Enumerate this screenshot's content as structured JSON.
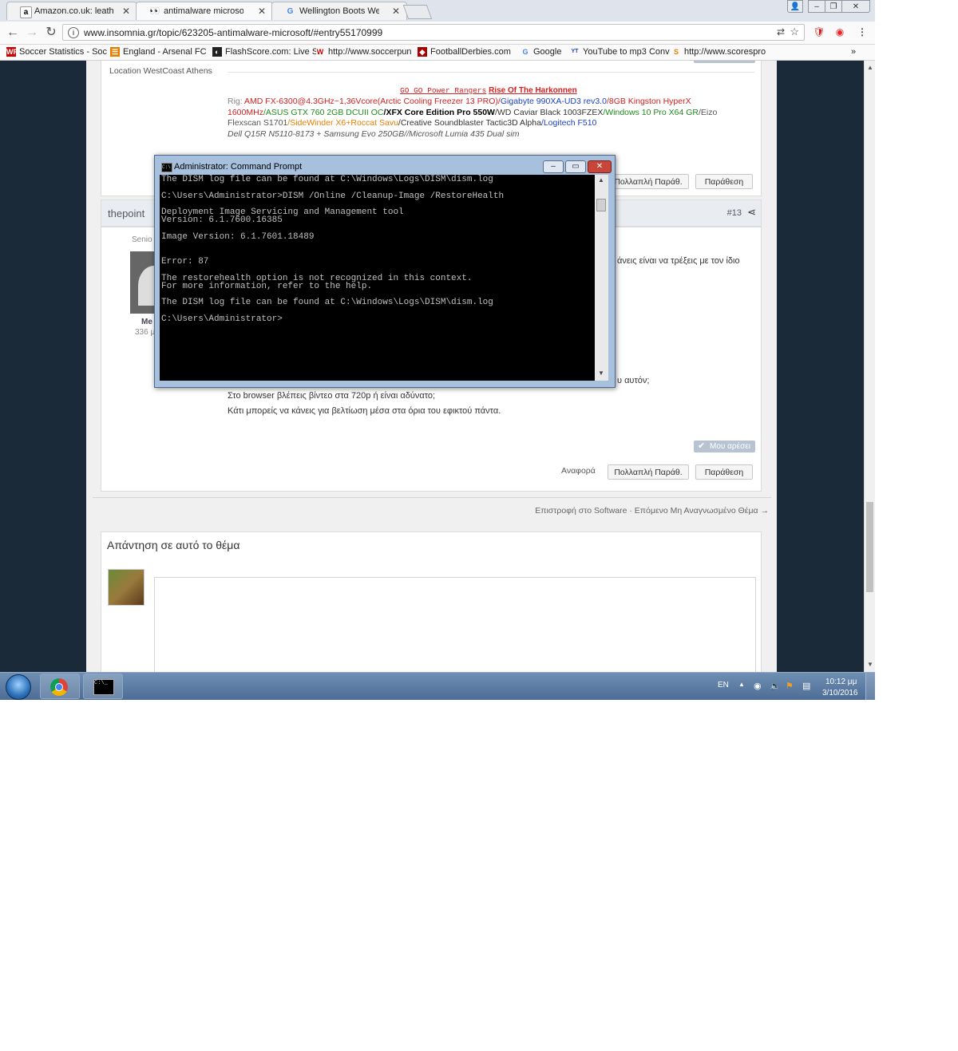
{
  "browser": {
    "tabs": [
      {
        "title": "Amazon.co.uk: leather - ",
        "favicon": "amazon-favicon",
        "active": false
      },
      {
        "title": "antimalware microsoft - ",
        "favicon": "insomnia-favicon",
        "active": true
      },
      {
        "title": "Wellington Boots Wellin",
        "favicon": "google-favicon",
        "active": false
      }
    ],
    "url": "www.insomnia.gr/topic/623205-antimalware-microsoft/#entry55170999",
    "bookmarks": [
      {
        "label": "Soccer Statistics - Soc",
        "icon": "WP"
      },
      {
        "label": "England - Arsenal FC",
        "icon": "☰"
      },
      {
        "label": "FlashScore.com: Live S",
        "icon": "◐"
      },
      {
        "label": "http://www.soccerpun",
        "icon": "W"
      },
      {
        "label": "FootballDerbies.com",
        "icon": "◆"
      },
      {
        "label": "Google",
        "icon": "G"
      },
      {
        "label": "YouTube to mp3 Conv",
        "icon": "YT"
      },
      {
        "label": "http://www.scorespro",
        "icon": "S"
      }
    ],
    "overflow": "»"
  },
  "forum": {
    "location_label": "Location",
    "location_value": "WestCoast Athens",
    "like_label": "Μου αρέσει",
    "signature": {
      "line_a": "GO GO Power Rangers",
      "line_b": "Rise Of The Harkonnen",
      "rig_label": "Rig:",
      "rig_parts": [
        {
          "text": "AMD FX-6300@4.3GHz~1,36Vcore(Arctic Cooling Freezer 13 PRO)/",
          "color": "#d42020"
        },
        {
          "text": "Gigabyte 990XA-UD3 rev3.0",
          "color": "#1c3fc8"
        },
        {
          "text": "/",
          "color": "#d42020"
        },
        {
          "text": "8GB Kingston HyperX 1600MHz",
          "color": "#d42020"
        },
        {
          "text": "/",
          "color": "#1f8a1f"
        },
        {
          "text": "ASUS GTX 760 2GB DCUII OC",
          "color": "#1f8a1f"
        },
        {
          "text": "/",
          "color": "#000000"
        },
        {
          "text": "XFX Core Edition Pro 550W",
          "color": "#000000"
        },
        {
          "text": "/WD Caviar Black 1003FZEX",
          "color": "#333333"
        },
        {
          "text": "/Windows 10 Pro X64 GR",
          "color": "#1f8a1f"
        },
        {
          "text": "/Eizo Flexscan S1701",
          "color": "#555555"
        },
        {
          "text": "/SideWinder X6+Roccat Savu",
          "color": "#e67e00"
        },
        {
          "text": "/Creative Soundblaster Tactic3D Alpha",
          "color": "#333333"
        },
        {
          "text": "/Logitech F510",
          "color": "#1c3fc8"
        }
      ],
      "line_last": "Dell Q15R N5110-8173 + Samsung Evo 250GB//Microsoft Lumia 435 Dual sim"
    },
    "buttons": {
      "report": "Αναφορά",
      "multiquote": "Πολλαπλή Παράθ.",
      "quote": "Παράθεση"
    },
    "post2": {
      "author": "thepoint",
      "post_number": "#13",
      "rank_partial": "Senio",
      "name_partial": "Me",
      "count_partial": "336 μ",
      "text_right_1": "άνεις είναι να τρέξεις με τον ίδιο",
      "text_right_2": "υ αυτόν;",
      "line_1": "Στο browser βλέπεις βίντεο στα 720p ή είναι αδύνατο;",
      "line_2": "Κάτι μπορείς να κάνεις για βελτίωση μέσα στα όρια του εφικτού πάντα."
    },
    "nav_links": "Επιστροφή στο Software · Επόμενο Μη Αναγνωσμένο Θέμα →",
    "reply_title": "Απάντηση σε αυτό το θέμα"
  },
  "cmd": {
    "title": "Administrator: Command Prompt",
    "output": "The DISM log file can be found at C:\\Windows\\Logs\\DISM\\dism.log\n\nC:\\Users\\Administrator>DISM /Online /Cleanup-Image /RestoreHealth\n\nDeployment Image Servicing and Management tool\nVersion: 6.1.7600.16385\n\nImage Version: 6.1.7601.18489\n\n\nError: 87\n\nThe restorehealth option is not recognized in this context.\nFor more information, refer to the help.\n\nThe DISM log file can be found at C:\\Windows\\Logs\\DISM\\dism.log\n\nC:\\Users\\Administrator>"
  },
  "taskbar": {
    "language": "EN",
    "time": "10:12 μμ",
    "date": "3/10/2016"
  }
}
